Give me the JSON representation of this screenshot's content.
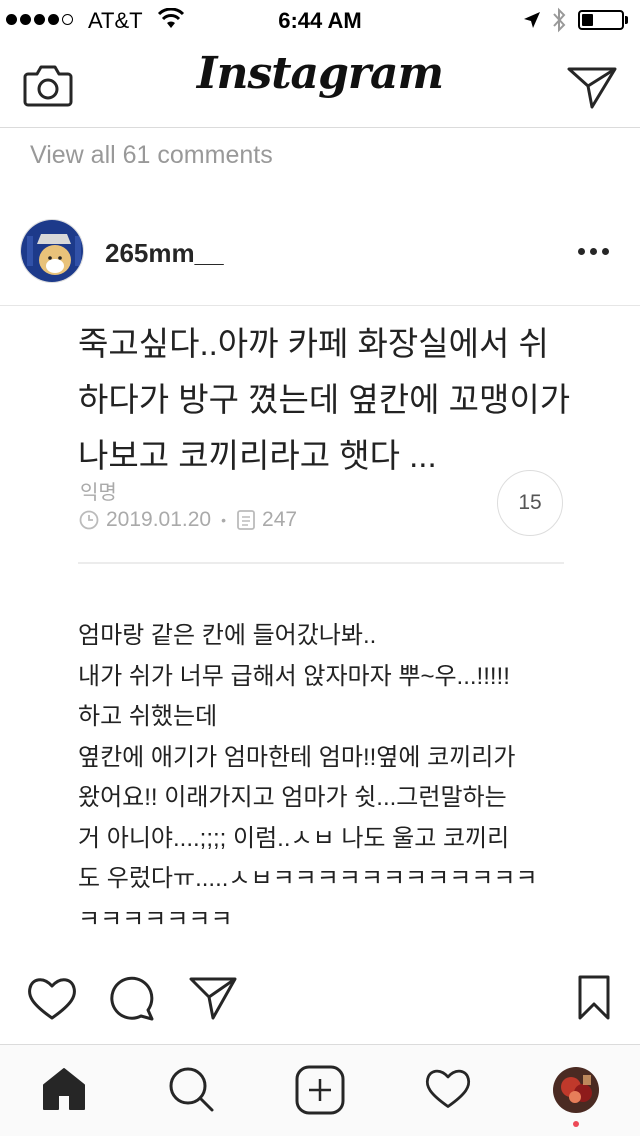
{
  "status_bar": {
    "carrier": "AT&T",
    "time": "6:44 AM",
    "battery_level": 0.25
  },
  "header": {
    "logo": "Instagram",
    "icons": [
      "camera-icon",
      "direct-message-icon"
    ]
  },
  "comments": {
    "view_all": "View all 61 comments"
  },
  "post": {
    "username": "265mm__",
    "image": {
      "title": "죽고싶다..아까 카페 화장실에서 쉬하다가 방구 꼈는데 옆칸에 꼬맹이가 나보고 코끼리라고 햇다 ...",
      "author": "익명",
      "date": "2019.01.20",
      "views": "247",
      "comment_count": "15",
      "body": "엄마랑 같은 칸에 들어갔나봐..\n내가 쉬가 너무 급해서 앉자마자 뿌~우...!!!!!\n하고 쉬했는데\n옆칸에 애기가 엄마한테 엄마!!옆에 코끼리가\n왔어요!! 이래가지고 엄마가 쉿...그런말하는\n거 아니야....;;;; 이럼..ㅅㅂ 나도 울고 코끼리\n도 우렀다ㅠ.....ㅅㅂㅋㅋㅋㅋㅋㅋㅋㅋㅋㅋㅋㅋ\nㅋㅋㅋㅋㅋㅋㅋ"
    }
  },
  "actions": [
    "heart-icon",
    "comment-icon",
    "share-icon",
    "bookmark-icon"
  ],
  "tabbar": [
    "home-icon",
    "search-icon",
    "new-post-icon",
    "activity-icon",
    "profile-avatar"
  ],
  "colors": {
    "notification_dot": "#ed4956",
    "muted_text": "#999999"
  }
}
